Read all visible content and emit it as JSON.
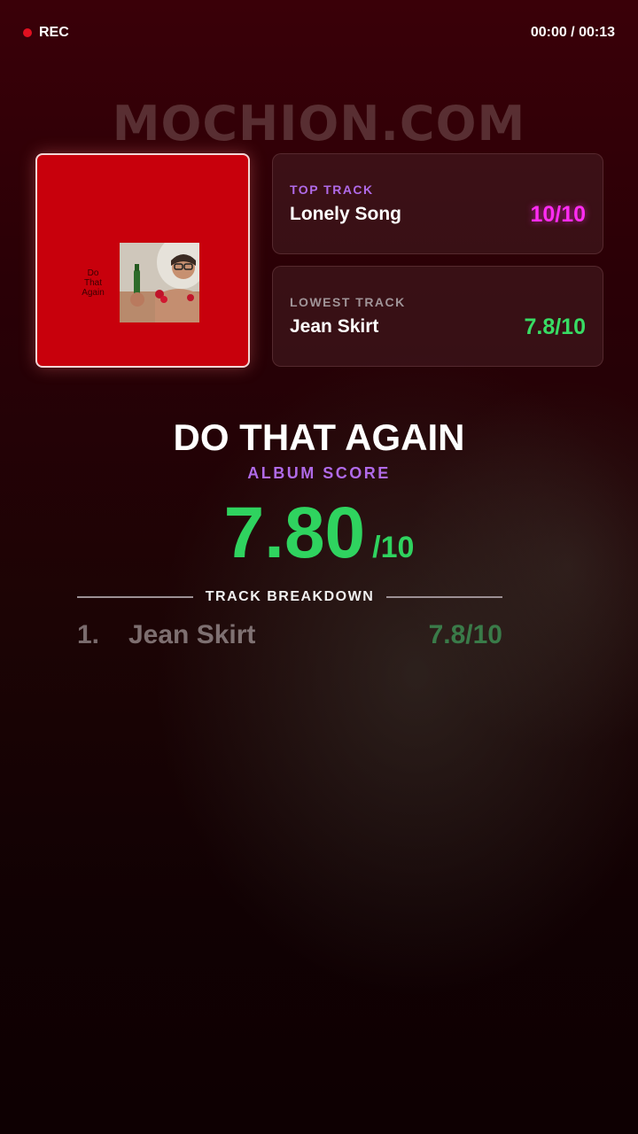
{
  "recording": {
    "label": "REC",
    "time": "00:00 / 00:13"
  },
  "watermark": "MOCHION.COM",
  "cover": {
    "text_lines": [
      "Do",
      "That",
      "Again"
    ]
  },
  "top_track": {
    "label": "TOP TRACK",
    "title": "Lonely Song",
    "score": "10/10"
  },
  "lowest_track": {
    "label": "LOWEST TRACK",
    "title": "Jean Skirt",
    "score": "7.8/10"
  },
  "album": {
    "title": "DO THAT AGAIN",
    "score_label": "ALBUM SCORE",
    "score": "7.80",
    "score_denominator": "/10"
  },
  "breakdown": {
    "label": "TRACK BREAKDOWN",
    "tracks": [
      {
        "number": "1.",
        "name": "Jean Skirt",
        "score": "7.8/10"
      }
    ]
  },
  "colors": {
    "accent_purple": "#b06ae8",
    "top_score_magenta": "#ff2cf2",
    "score_green": "#2fd35f",
    "rec_red": "#e01020",
    "cover_red": "#c8000c"
  }
}
